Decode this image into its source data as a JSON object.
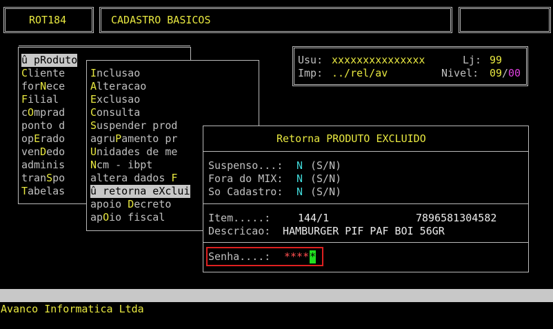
{
  "header": {
    "routine": "ROT184",
    "title": "CADASTRO BASICOS",
    "right": ""
  },
  "user_info": {
    "usu_label": "Usu:",
    "usu_value": "xxxxxxxxxxxxxxx",
    "lj_label": "Lj:",
    "lj_value": "99",
    "imp_label": "Imp:",
    "imp_value": "../rel/av",
    "nivel_label": "Nivel:",
    "nivel_value_a": "09",
    "nivel_sep": "/",
    "nivel_value_b": "00"
  },
  "main_menu": {
    "items": [
      {
        "hot": "",
        "pre": "û pRoduto",
        "post": ""
      },
      {
        "pre": "",
        "hot": "C",
        "post": "liente"
      },
      {
        "pre": "for",
        "hot": "N",
        "post": "ece"
      },
      {
        "pre": "",
        "hot": "F",
        "post": "ilial"
      },
      {
        "pre": "c",
        "hot": "O",
        "post": "mprad"
      },
      {
        "pre": "ponto d",
        "hot": "",
        "post": ""
      },
      {
        "pre": "op",
        "hot": "E",
        "post": "rado"
      },
      {
        "pre": "ven",
        "hot": "D",
        "post": "edo"
      },
      {
        "pre": "adminis",
        "hot": "",
        "post": ""
      },
      {
        "pre": "tran",
        "hot": "S",
        "post": "po"
      },
      {
        "pre": "",
        "hot": "T",
        "post": "abelas"
      }
    ]
  },
  "sub_menu": {
    "items": [
      {
        "pre": "",
        "hot": "I",
        "post": "nclusao"
      },
      {
        "pre": "",
        "hot": "A",
        "post": "lteracao"
      },
      {
        "pre": "",
        "hot": "E",
        "post": "xclusao"
      },
      {
        "pre": "",
        "hot": "C",
        "post": "onsulta"
      },
      {
        "pre": "",
        "hot": "S",
        "post": "uspender prod"
      },
      {
        "pre": "agru",
        "hot": "P",
        "post": "amento pr"
      },
      {
        "pre": "",
        "hot": "U",
        "post": "nidades de me"
      },
      {
        "pre": "",
        "hot": "N",
        "post": "cm - ibpt"
      },
      {
        "pre": "altera dados ",
        "hot": "F",
        "post": ""
      },
      {
        "pre": "û retorna eXclui",
        "hot": "",
        "post": ""
      },
      {
        "pre": "apoio ",
        "hot": "D",
        "post": "ecreto"
      },
      {
        "pre": "ap",
        "hot": "O",
        "post": "io fiscal"
      }
    ]
  },
  "dialog": {
    "title": "Retorna PRODUTO EXCLUIDO",
    "suspenso_label": "Suspenso...:",
    "suspenso_value": "N",
    "suspenso_hint": "(S/N)",
    "mix_label": "Fora do MIX:",
    "mix_value": "N",
    "mix_hint": "(S/N)",
    "cad_label": "So Cadastro:",
    "cad_value": "N",
    "cad_hint": "(S/N)",
    "item_label": "Item.....:",
    "item_value": "144/1",
    "item_code": "7896581304582",
    "desc_label": "Descricao:",
    "desc_value": "HAMBURGER PIF PAF BOI 56GR",
    "senha_label": "Senha....:",
    "senha_value": "****",
    "senha_cursor": "*"
  },
  "status": {
    "company": "Avanco Informatica Ltda"
  }
}
